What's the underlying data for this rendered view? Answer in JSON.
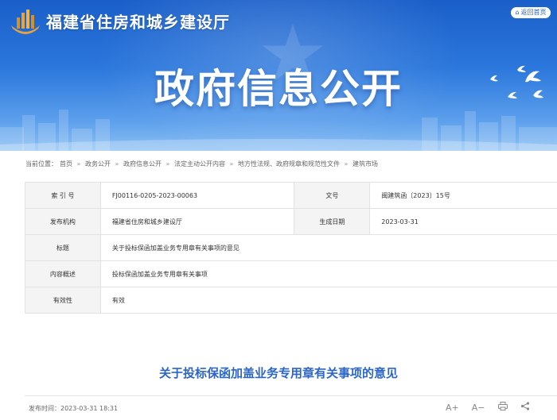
{
  "header": {
    "site_title": "福建省住房和城乡建设厅",
    "back_home": "返回首页",
    "hero_title": "政府信息公开"
  },
  "breadcrumb": {
    "prefix": "当前位置：",
    "items": [
      "首页",
      "政务公开",
      "政府信息公开",
      "法定主动公开内容",
      "地方性法规、政府规章和规范性文件",
      "建筑市场"
    ],
    "separator": "»"
  },
  "meta": {
    "index_label": "索 引 号",
    "index_value": "FJ00116-0205-2023-00063",
    "doc_no_label": "文号",
    "doc_no_value": "闽建筑函〔2023〕15号",
    "org_label": "发布机构",
    "org_value": "福建省住房和城乡建设厅",
    "date_label": "生成日期",
    "date_value": "2023-03-31",
    "title_label": "标题",
    "title_value": "关于投标保函加盖业务专用章有关事项的意见",
    "summary_label": "内容概述",
    "summary_value": "投标保函加盖业务专用章有关事项",
    "validity_label": "有效性",
    "validity_value": "有效"
  },
  "article": {
    "title": "关于投标保函加盖业务专用章有关事项的意见",
    "publish_time": "发布时间：2023-03-31 18:31"
  },
  "tools": {
    "font_increase": "A+",
    "font_decrease": "A−",
    "icons": [
      "font-increase-icon",
      "font-decrease-icon",
      "print-icon",
      "share-icon"
    ]
  },
  "colors": {
    "banner_top": "#1a5fc9",
    "banner_bottom": "#8cc0f3",
    "accent": "#2b66c7"
  }
}
